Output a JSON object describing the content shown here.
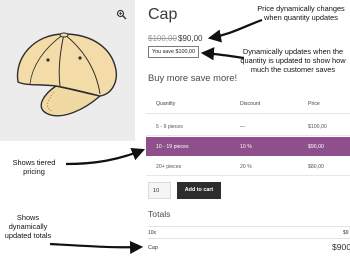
{
  "product": {
    "title": "Cap",
    "price_old": "$100,00",
    "price_new": "$90,00",
    "savings_badge": "You save $100,00"
  },
  "section_heading": "Buy more save more!",
  "tier_table": {
    "headers": [
      "Quantity",
      "Discount",
      "Price"
    ],
    "rows": [
      [
        "5 - 9 pieces",
        "—",
        "$100,00"
      ],
      [
        "10 - 19 pieces",
        "10 %",
        "$90,00"
      ],
      [
        "20+ pieces",
        "20 %",
        "$80,00"
      ]
    ],
    "highlighted_row": 1,
    "highlight_color": "#8e4f8c"
  },
  "cart": {
    "quantity": "10",
    "add_to_cart_label": "Add to cart"
  },
  "totals": {
    "heading": "Totals",
    "qty_label": "10x",
    "qty_value": "$9",
    "item_name": "Cap",
    "item_price": "$900"
  },
  "annotations": {
    "price": "Price dynamically changes when quantity updates",
    "savings": "Dynamically updates when the quantity is updated to show how much the customer saves",
    "tiers": "Shows tiered pricing",
    "totals": "Shows dynamically updated totals"
  },
  "icons": {
    "zoom": "magnifier-icon"
  }
}
